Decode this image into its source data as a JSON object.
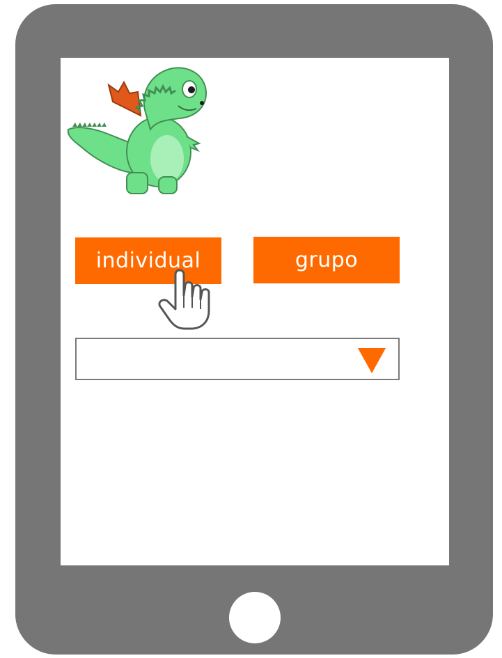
{
  "buttons": {
    "individual_label": "individual",
    "grupo_label": "grupo"
  },
  "dropdown": {
    "selected_value": ""
  },
  "icons": {
    "mascot": "green-dragon-mascot",
    "cursor": "hand-pointer-icon",
    "dropdown_arrow": "triangle-down-icon",
    "home": "home-button"
  },
  "colors": {
    "accent": "#ff6a00",
    "device_frame": "#767676",
    "dragon_body": "#6fe08a",
    "dragon_wing": "#e0581a"
  }
}
